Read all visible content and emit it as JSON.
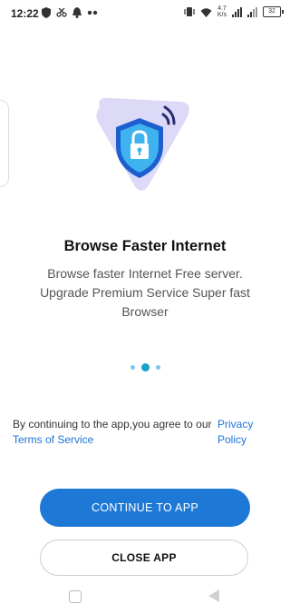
{
  "status_bar": {
    "time": "12:22",
    "network_speed_value": "4.7",
    "network_speed_unit": "K/s",
    "battery_level": "32",
    "left_icons": [
      "shield-icon",
      "scissors-icon",
      "bell-icon",
      "dots-icon"
    ],
    "right_icons": [
      "vibrate-icon",
      "wifi-icon",
      "signal-icon",
      "signal-icon",
      "battery-icon"
    ]
  },
  "onboarding": {
    "title": "Browse Faster Internet",
    "subtitle": "Browse faster Internet Free server. Upgrade Premium Service Super fast Browser",
    "page_indicator": {
      "count": 3,
      "active_index": 1
    },
    "hero_icon": "shield-lock-icon"
  },
  "consent": {
    "text": "By continuing to the app,you agree to our",
    "privacy_link": "Privacy Policy",
    "terms_link": "Terms of Service"
  },
  "buttons": {
    "continue": "CONTINUE TO APP",
    "close": "CLOSE APP"
  },
  "colors": {
    "primary": "#1e78d6",
    "link": "#1a73d9",
    "dot_active": "#1aa0c9",
    "hero_bg": "#dcdaf7"
  }
}
